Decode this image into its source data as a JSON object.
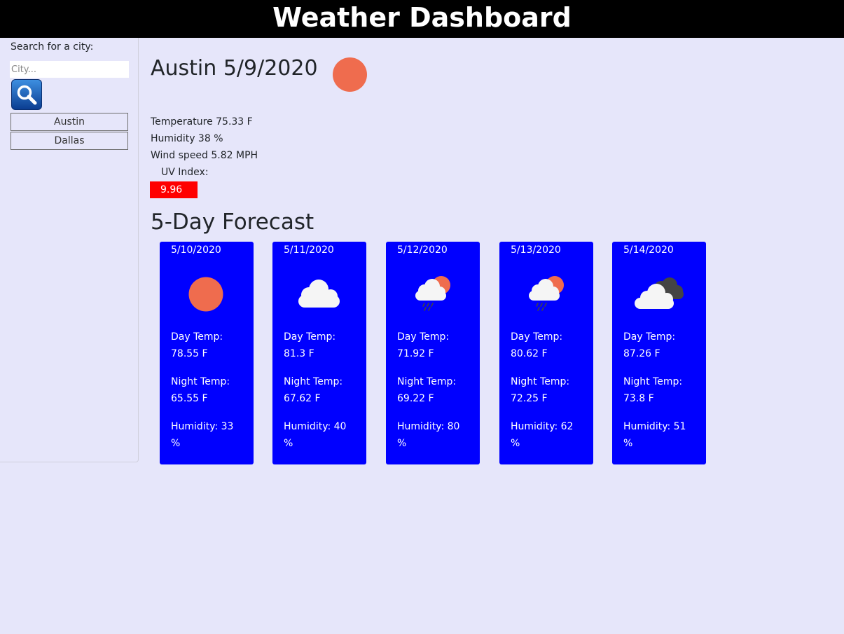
{
  "header": {
    "title": "Weather Dashboard"
  },
  "sidebar": {
    "search_label": "Search for a city:",
    "search_placeholder": "City...",
    "search_value": "",
    "search_button_icon": "search-icon",
    "history": [
      "Austin",
      "Dallas"
    ]
  },
  "current": {
    "title": "Austin 5/9/2020",
    "icon": "sun-icon",
    "temperature": "Temperature 75.33 F",
    "humidity": "Humidity 38 %",
    "wind": "Wind speed 5.82 MPH",
    "uv_label": "UV Index:",
    "uv_value": "9.96",
    "uv_color": "#ff0000"
  },
  "forecast": {
    "title": "5-Day Forecast",
    "day_label": "Day Temp:",
    "night_label": "Night Temp:",
    "humidity_label_prefix": "Humidity:",
    "card_color": "#0000ff",
    "days": [
      {
        "date": "5/10/2020",
        "icon": "sun-icon",
        "day_temp": "78.55 F",
        "night_temp": "65.55 F",
        "humidity_a": "Humidity: 33",
        "humidity_b": "%"
      },
      {
        "date": "5/11/2020",
        "icon": "cloud-icon",
        "day_temp": "81.3 F",
        "night_temp": "67.62 F",
        "humidity_a": "Humidity: 40",
        "humidity_b": "%"
      },
      {
        "date": "5/12/2020",
        "icon": "rain-sun-icon",
        "day_temp": "71.92 F",
        "night_temp": "69.22 F",
        "humidity_a": "Humidity: 80",
        "humidity_b": "%"
      },
      {
        "date": "5/13/2020",
        "icon": "rain-sun-icon",
        "day_temp": "80.62 F",
        "night_temp": "72.25 F",
        "humidity_a": "Humidity: 62",
        "humidity_b": "%"
      },
      {
        "date": "5/14/2020",
        "icon": "clouds-icon",
        "day_temp": "87.26 F",
        "night_temp": "73.8 F",
        "humidity_a": "Humidity: 51",
        "humidity_b": "%"
      }
    ]
  },
  "colors": {
    "background": "#e6e6fa",
    "header_bg": "#000000",
    "sun": "#ef6c4e"
  }
}
